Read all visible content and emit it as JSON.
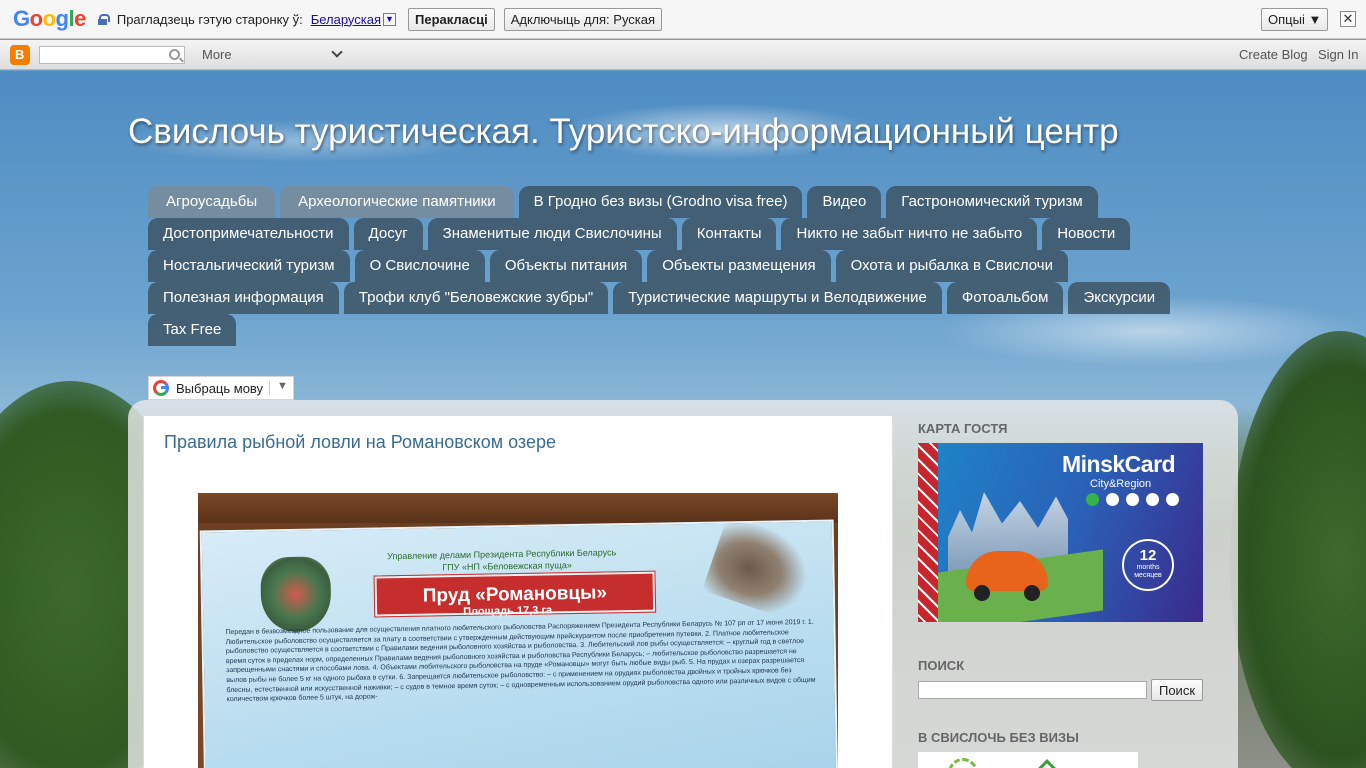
{
  "translate_bar": {
    "logo": [
      "G",
      "o",
      "o",
      "g",
      "l",
      "e"
    ],
    "prompt": "Прагладзець гэтую старонку ў:",
    "language": "Беларуская",
    "dropdown_arrow": "▼",
    "translate_button": "Перакласці",
    "disable_button": "Адключыць для: Руская",
    "options_button": "Опцыі ▼",
    "close_symbol": "✕"
  },
  "navbar": {
    "more_label": "More",
    "create_blog": "Create Blog",
    "sign_in": "Sign In"
  },
  "site": {
    "title": "Свислочь туристическая. Туристско-информационный центр"
  },
  "tabs": [
    "Агроусадьбы",
    "Археологические памятники",
    "В Гродно без визы (Grodno visa free)",
    "Видео",
    "Гастрономический туризм",
    "Достопримечательности",
    "Досуг",
    "Знаменитые люди Свислочины",
    "Контакты",
    "Никто не забыт ничто не забыто",
    "Новости",
    "Ностальгический туризм",
    "О Свислочине",
    "Объекты питания",
    "Объекты размещения",
    "Охота и рыбалка в Свислочи",
    "Полезная информация",
    "Трофи клуб \"Беловежские зубры\"",
    "Туристические маршруты и Велодвижение",
    "Фотоальбом",
    "Экскурсии",
    "Tax Free"
  ],
  "language_widget": {
    "label": "Выбраць мову",
    "arrow": "▼"
  },
  "post": {
    "title": "Правила рыбной ловли на Романовском озере",
    "sign": {
      "org_line1": "Управление делами Президента Республики Беларусь",
      "org_line2": "ГПУ «НП «Беловежская пуща»",
      "name": "Пруд «Романовцы»",
      "area": "Площадь 17,3 га",
      "text": "Передан в безвозмездное пользование для осуществления платного любительского рыболовства Распоряжением Президента Республики Беларусь № 107 рп от 17 июня 2019 г. 1. Любительское рыболовство осуществляется за плату в соответствии с утвержденным действующим прейскурантом после приобретения путевки. 2. Платное любительское рыболовство осуществляется в соответствии с Правилами ведения рыболовного хозяйства и рыболовства. 3. Любительский лов рыбы осуществляется: – круглый год в светлое время суток в пределах норм, определенных Правилами ведения рыболовного хозяйства и рыболовства Республики Беларусь; – любительское рыболовство разрешается не запрещенными снастями и способами лова. 4. Объектами любительского рыболовства на пруде «Романовцы» могут быть любые виды рыб. 5. На прудах и озерах разрешается вылов рыбы не более 5 кг на одного рыбака в сутки. 6. Запрещается любительское рыболовство: – с применением на орудиях рыболовства двойных и тройных крючков без блесны, естественной или искусственной наживки; – с судов в темное время суток; – с одновременным использованием орудий рыболовства одного или различных видов с общим количеством крючков более 5 штук, на дорож-"
    }
  },
  "sidebar": {
    "guest_card_heading": "Карта гостя",
    "minsk_card": {
      "brand": "MinskCard",
      "sub": "City&Region",
      "badge_number": "12",
      "badge_line1": "months",
      "badge_line2": "месяцев"
    },
    "search_heading": "Поиск",
    "search_button": "Поиск",
    "visa_heading": "В Свислочь без визы"
  }
}
